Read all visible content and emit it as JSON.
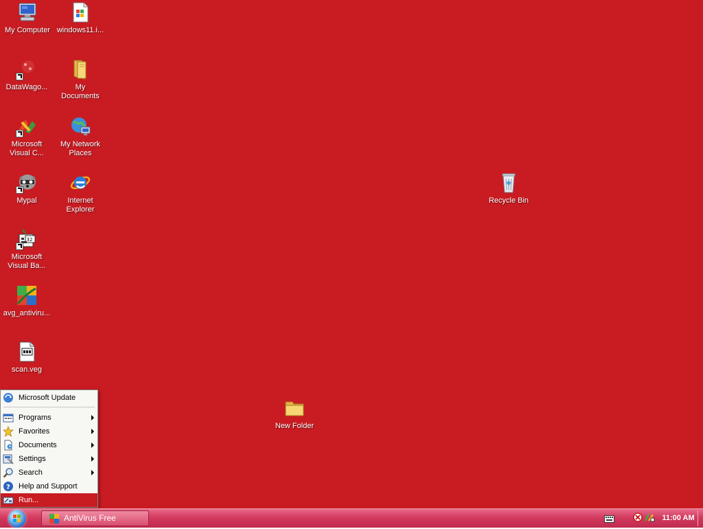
{
  "colors": {
    "desktop_background": "#c91b22",
    "taskbar": "#d23a5e",
    "menu_highlight": "#c91b22"
  },
  "desktop": {
    "icons": [
      {
        "label": "My Computer",
        "icon": "my-computer-icon"
      },
      {
        "label": "windows11.i...",
        "icon": "file-icon"
      },
      {
        "label": "DataWago...",
        "icon": "datawago-icon"
      },
      {
        "label": "My\nDocuments",
        "icon": "my-documents-folder-icon"
      },
      {
        "label": "Microsoft\nVisual C...",
        "icon": "visual-c-icon"
      },
      {
        "label": "My Network\nPlaces",
        "icon": "network-places-icon"
      },
      {
        "label": "Mypal",
        "icon": "mypal-icon"
      },
      {
        "label": "Internet\nExplorer",
        "icon": "internet-explorer-icon"
      },
      {
        "label": "Microsoft\nVisual Ba...",
        "icon": "visual-basic-icon"
      },
      {
        "label": "avg_antiviru...",
        "icon": "avg-antivirus-icon"
      },
      {
        "label": "scan.veg",
        "icon": "veg-file-icon"
      },
      {
        "label": "Recycle Bin",
        "icon": "recycle-bin-icon"
      },
      {
        "label": "New Folder",
        "icon": "folder-icon"
      }
    ]
  },
  "start_menu": {
    "top_item": {
      "label": "Microsoft Update",
      "icon": "windows-update-icon"
    },
    "items": [
      {
        "label": "Programs",
        "icon": "programs-icon",
        "submenu": true
      },
      {
        "label": "Favorites",
        "icon": "star-icon",
        "submenu": true
      },
      {
        "label": "Documents",
        "icon": "documents-icon",
        "submenu": true
      },
      {
        "label": "Settings",
        "icon": "settings-icon",
        "submenu": true
      },
      {
        "label": "Search",
        "icon": "search-icon",
        "submenu": true
      },
      {
        "label": "Help and Support",
        "icon": "help-icon",
        "submenu": false
      },
      {
        "label": "Run...",
        "icon": "run-icon",
        "submenu": false,
        "highlighted": true
      }
    ]
  },
  "taskbar": {
    "start_icon": "windows-orb-icon",
    "tasks": [
      {
        "label": "AntiVirus Free",
        "icon": "avg-antivirus-icon"
      }
    ],
    "tray": {
      "icons": [
        "keyboard-icon",
        "shield-icon",
        "network-icon"
      ],
      "clock": "11:00 AM"
    }
  }
}
